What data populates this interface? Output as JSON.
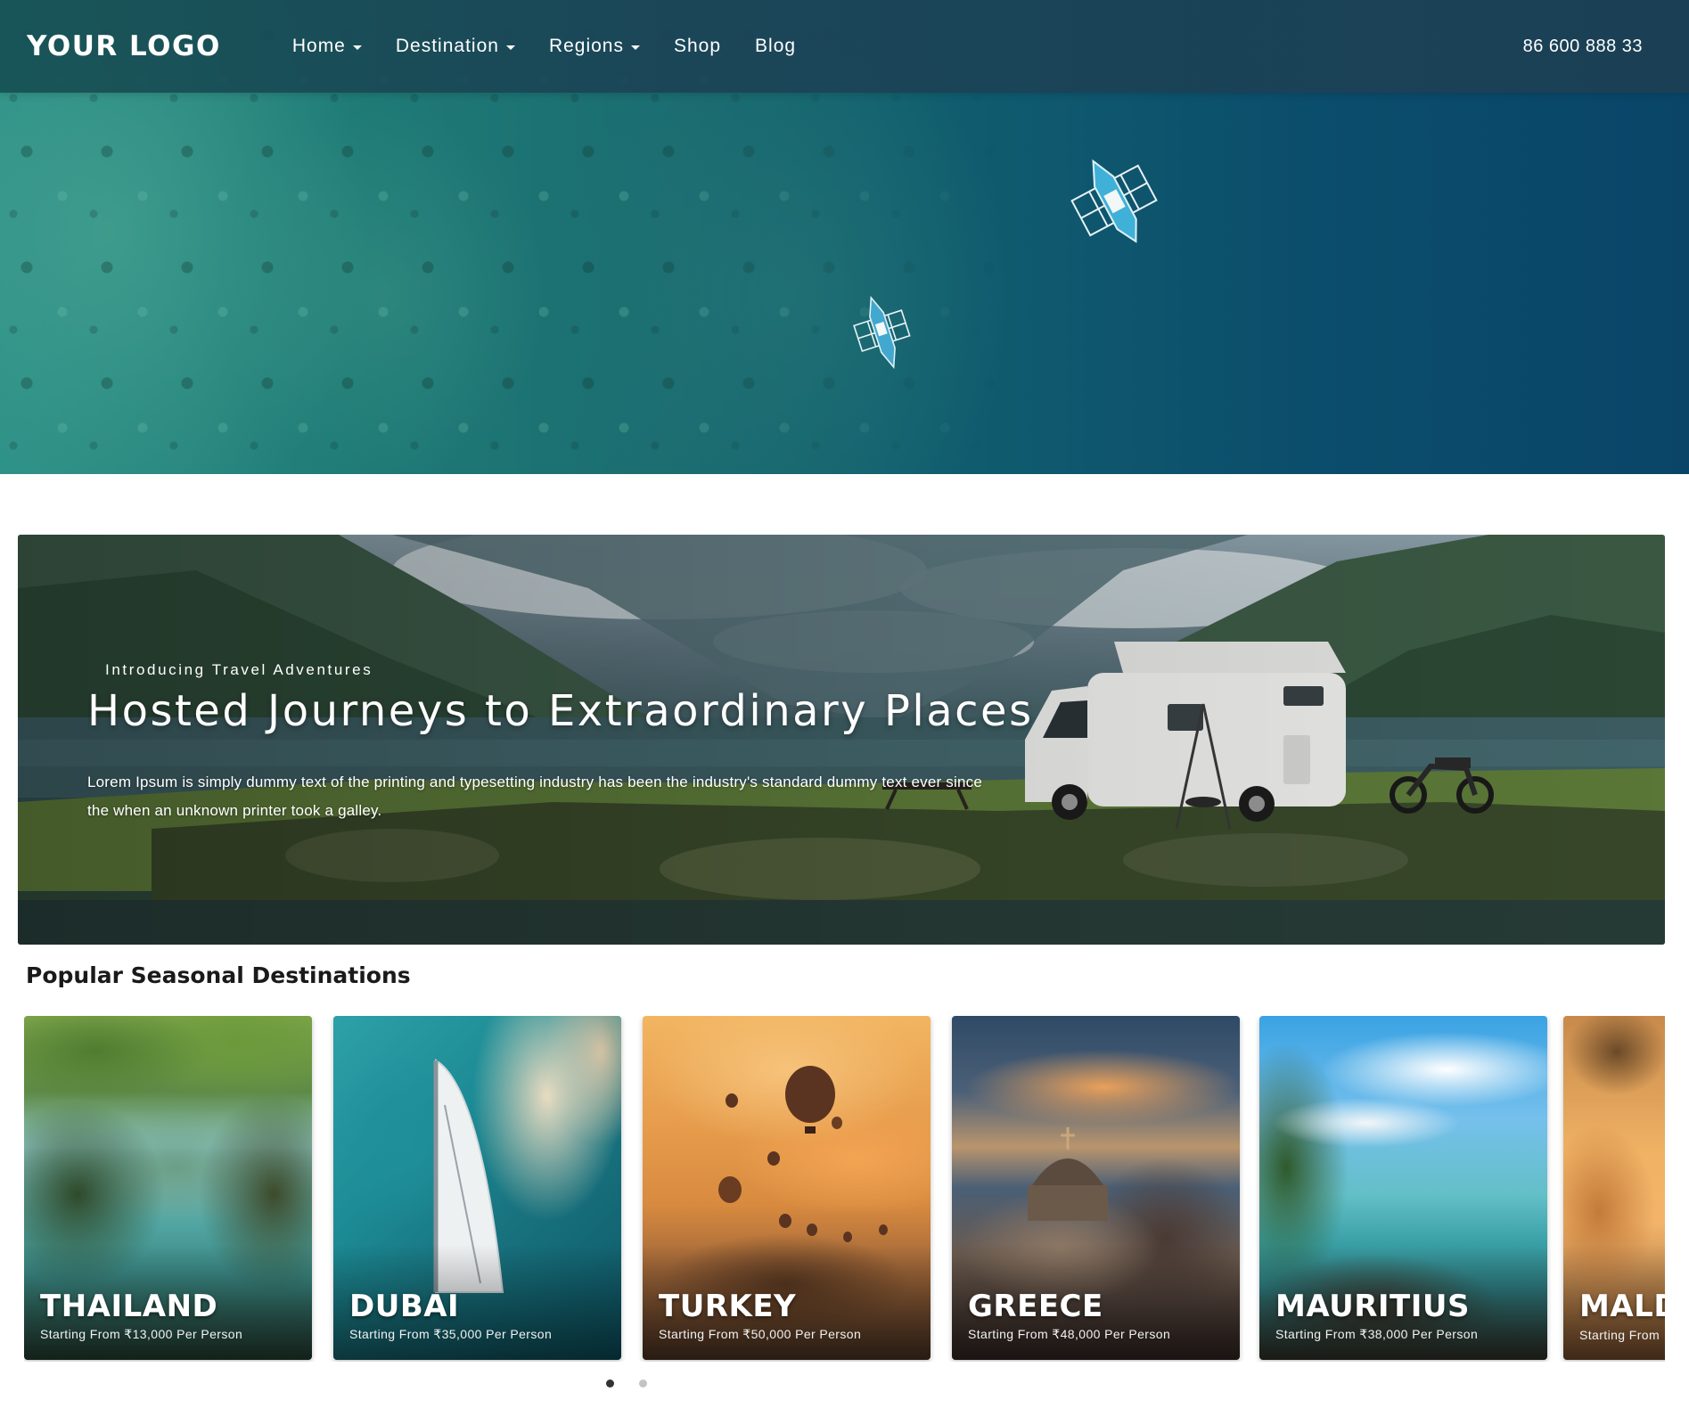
{
  "nav": {
    "logo": "YOUR LOGO",
    "items": [
      {
        "label": "Home",
        "dropdown": true
      },
      {
        "label": "Destination",
        "dropdown": true
      },
      {
        "label": "Regions",
        "dropdown": true
      },
      {
        "label": "Shop",
        "dropdown": false
      },
      {
        "label": "Blog",
        "dropdown": false
      }
    ],
    "phone": "86 600 888 33"
  },
  "banner": {
    "eyebrow": "Introducing Travel Adventures",
    "title": "Hosted Journeys to Extraordinary Places",
    "description": "Lorem Ipsum is simply dummy text of the printing and typesetting industry has been the industry's standard dummy text ever since the when an unknown printer took a galley."
  },
  "destinations": {
    "heading": "Popular Seasonal Destinations",
    "cards": [
      {
        "name": "THAILAND",
        "price": "Starting From ₹13,000 Per Person"
      },
      {
        "name": "DUBAI",
        "price": "Starting From ₹35,000 Per Person"
      },
      {
        "name": "TURKEY",
        "price": "Starting From ₹50,000 Per Person"
      },
      {
        "name": "GREECE",
        "price": "Starting From ₹48,000 Per Person"
      },
      {
        "name": "MAURITIUS",
        "price": "Starting From ₹38,000 Per Person"
      },
      {
        "name": "MALD",
        "price": "Starting From"
      }
    ],
    "pagination": {
      "pages": 2,
      "active": 1
    }
  },
  "colors": {
    "navbar": "#1c4a56",
    "hero_water": "#0b4d6c",
    "text_light": "#ffffff",
    "heading_dark": "#1a1a1a",
    "dot_active": "#333333",
    "dot_inactive": "#c4c4c4"
  }
}
